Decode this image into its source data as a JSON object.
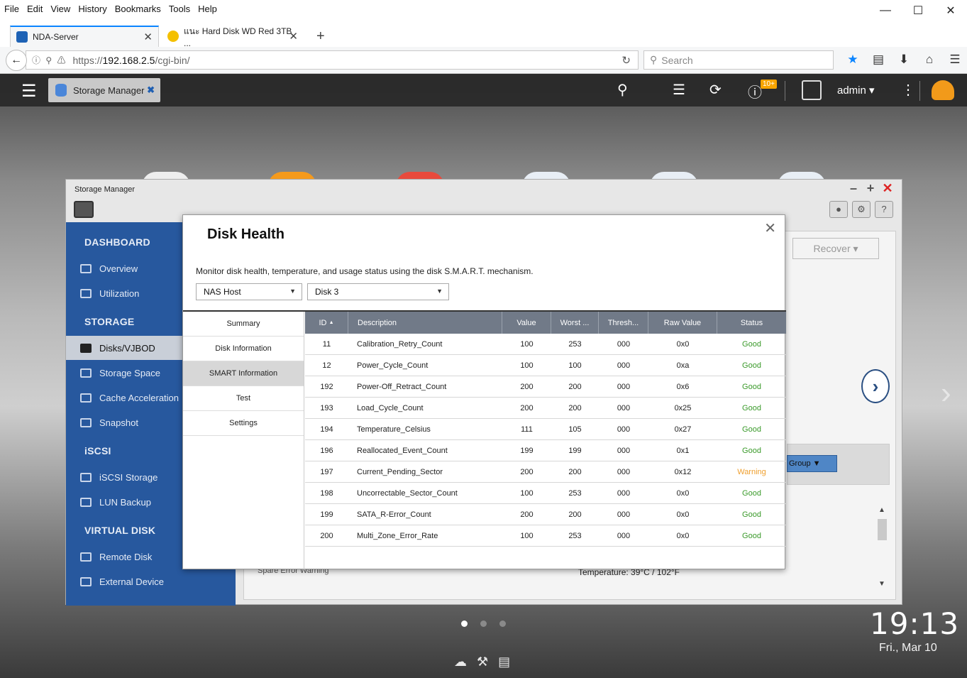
{
  "browser": {
    "menu": [
      "File",
      "Edit",
      "View",
      "History",
      "Bookmarks",
      "Tools",
      "Help"
    ],
    "tabs": [
      {
        "title": "NDA-Server",
        "active": true
      },
      {
        "title": "แนะ Hard Disk WD Red 3TB ...",
        "active": false
      }
    ],
    "url_prefix": "https://",
    "url_host": "192.168.2.5",
    "url_path": "/cgi-bin/",
    "search_placeholder": "Search"
  },
  "qts": {
    "app_tab": "Storage Manager",
    "notification_badge": "10+",
    "user": "admin",
    "time": "19:13",
    "date": "Fri., Mar 10"
  },
  "storage_manager": {
    "title": "Storage Manager",
    "sections": [
      {
        "label": "DASHBOARD",
        "items": [
          "Overview",
          "Utilization"
        ]
      },
      {
        "label": "STORAGE",
        "items": [
          "Disks/VJBOD",
          "Storage Space",
          "Cache Acceleration",
          "Snapshot"
        ]
      },
      {
        "label": "iSCSI",
        "items": [
          "iSCSI Storage",
          "LUN Backup"
        ]
      },
      {
        "label": "VIRTUAL DISK",
        "items": [
          "Remote Disk",
          "External Device"
        ]
      }
    ],
    "selected_item": "Disks/VJBOD",
    "recover_label": "Recover",
    "group_label": "Group",
    "temperature_text": "Temperature: 39°C / 102°F",
    "legend_text": "Spare    Error    Warning"
  },
  "dialog": {
    "title": "Disk Health",
    "description": "Monitor disk health, temperature, and usage status using the disk S.M.A.R.T. mechanism.",
    "host_select": "NAS Host",
    "disk_select": "Disk 3",
    "nav": [
      "Summary",
      "Disk Information",
      "SMART Information",
      "Test",
      "Settings"
    ],
    "selected_nav": "SMART Information",
    "columns": [
      "ID",
      "Description",
      "Value",
      "Worst ...",
      "Thresh...",
      "Raw Value",
      "Status"
    ],
    "rows": [
      {
        "id": "11",
        "desc": "Calibration_Retry_Count",
        "value": "100",
        "worst": "253",
        "thresh": "000",
        "raw": "0x0",
        "status": "Good"
      },
      {
        "id": "12",
        "desc": "Power_Cycle_Count",
        "value": "100",
        "worst": "100",
        "thresh": "000",
        "raw": "0xa",
        "status": "Good"
      },
      {
        "id": "192",
        "desc": "Power-Off_Retract_Count",
        "value": "200",
        "worst": "200",
        "thresh": "000",
        "raw": "0x6",
        "status": "Good"
      },
      {
        "id": "193",
        "desc": "Load_Cycle_Count",
        "value": "200",
        "worst": "200",
        "thresh": "000",
        "raw": "0x25",
        "status": "Good"
      },
      {
        "id": "194",
        "desc": "Temperature_Celsius",
        "value": "111",
        "worst": "105",
        "thresh": "000",
        "raw": "0x27",
        "status": "Good"
      },
      {
        "id": "196",
        "desc": "Reallocated_Event_Count",
        "value": "199",
        "worst": "199",
        "thresh": "000",
        "raw": "0x1",
        "status": "Good"
      },
      {
        "id": "197",
        "desc": "Current_Pending_Sector",
        "value": "200",
        "worst": "200",
        "thresh": "000",
        "raw": "0x12",
        "status": "Warning"
      },
      {
        "id": "198",
        "desc": "Uncorrectable_Sector_Count",
        "value": "100",
        "worst": "253",
        "thresh": "000",
        "raw": "0x0",
        "status": "Good"
      },
      {
        "id": "199",
        "desc": "SATA_R-Error_Count",
        "value": "200",
        "worst": "200",
        "thresh": "000",
        "raw": "0x0",
        "status": "Good"
      },
      {
        "id": "200",
        "desc": "Multi_Zone_Error_Rate",
        "value": "100",
        "worst": "253",
        "thresh": "000",
        "raw": "0x0",
        "status": "Good"
      }
    ],
    "colors": {
      "good": "#3a9a2a",
      "warning": "#ef9f2e",
      "header_bg": "#717a88"
    }
  }
}
